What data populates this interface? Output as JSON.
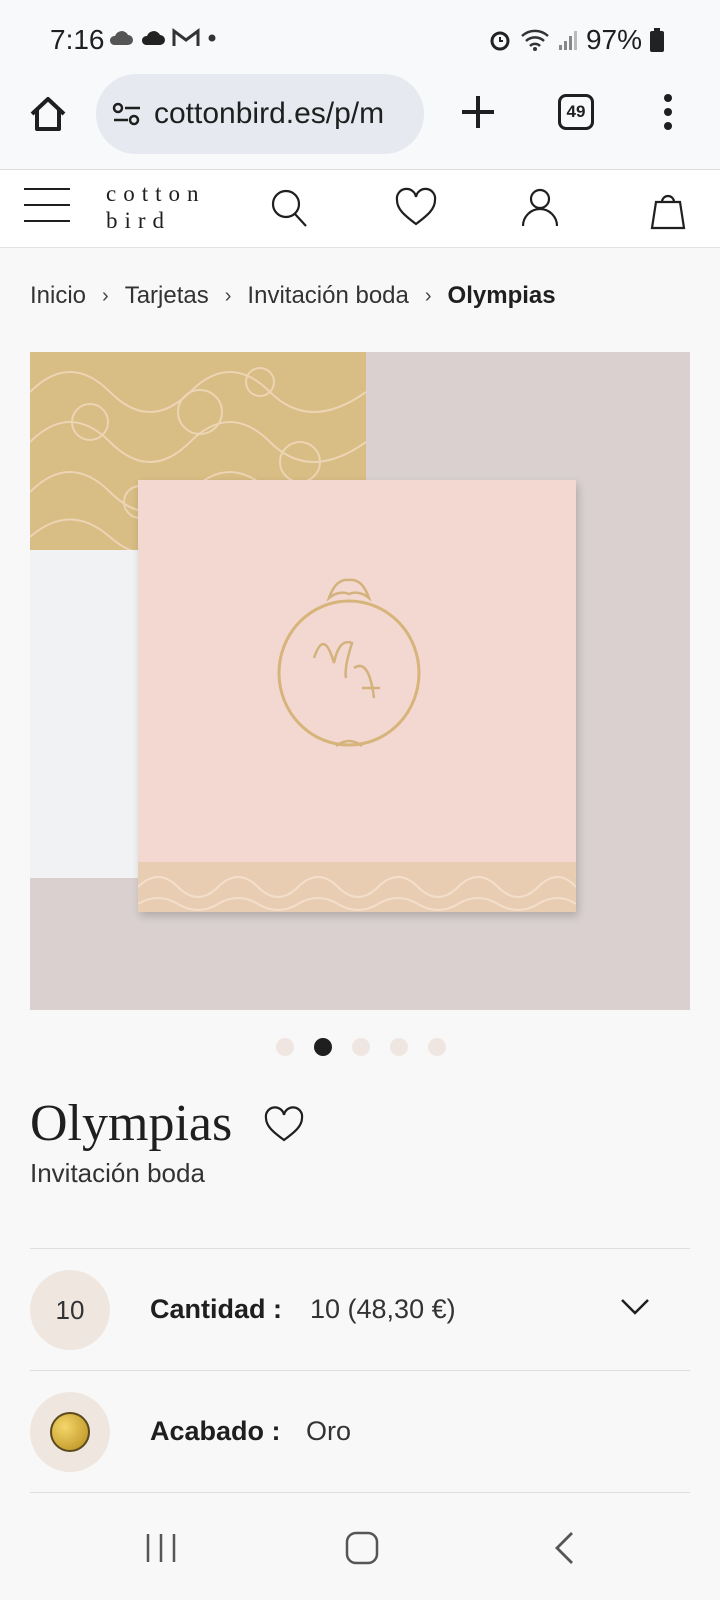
{
  "status_bar": {
    "time": "7:16",
    "battery": "97%"
  },
  "browser": {
    "url": "cottonbird.es/p/m",
    "tab_count": "49"
  },
  "site": {
    "logo_line1": "cotton",
    "logo_line2": "bird"
  },
  "breadcrumb": {
    "items": [
      "Inicio",
      "Tarjetas",
      "Invitación boda",
      "Olympias"
    ],
    "separator": "›"
  },
  "carousel": {
    "total": 5,
    "active_index": 1
  },
  "product": {
    "title": "Olympias",
    "subtitle": "Invitación boda"
  },
  "options": {
    "quantity": {
      "badge": "10",
      "label": "Cantidad :",
      "value": "10 (48,30 €)"
    },
    "finish": {
      "label": "Acabado :",
      "value": "Oro",
      "swatch_color": "#d4ac3a"
    }
  },
  "colors": {
    "background": "#f8f8f8",
    "card_pink": "#f2d8d1",
    "gold": "#d9bf86",
    "text": "#1f1f1f"
  }
}
